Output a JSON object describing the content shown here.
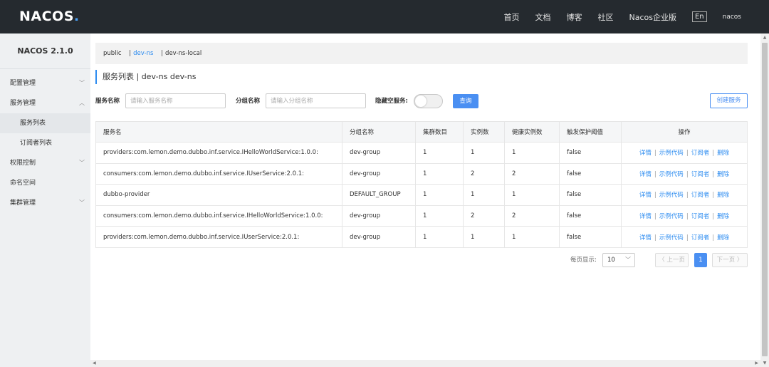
{
  "header": {
    "logo": "NACOS",
    "logo_dot": ".",
    "nav": [
      "首页",
      "文档",
      "博客",
      "社区",
      "Nacos企业版"
    ],
    "lang": "En",
    "user": "nacos"
  },
  "sidebar": {
    "title": "NACOS 2.1.0",
    "items": [
      {
        "label": "配置管理",
        "chevron": "﹀"
      },
      {
        "label": "服务管理",
        "chevron": "︿"
      },
      {
        "label": "服务列表"
      },
      {
        "label": "订阅者列表"
      },
      {
        "label": "权限控制",
        "chevron": "﹀"
      },
      {
        "label": "命名空间"
      },
      {
        "label": "集群管理",
        "chevron": "﹀"
      }
    ]
  },
  "namespaces": {
    "items": [
      "public",
      "dev-ns",
      "dev-ns-local"
    ],
    "separator": "|",
    "active": "dev-ns"
  },
  "page_title": "服务列表 | dev-ns dev-ns",
  "filters": {
    "service_name_label": "服务名称",
    "service_name_placeholder": "请输入服务名称",
    "group_name_label": "分组名称",
    "group_name_placeholder": "请输入分组名称",
    "hide_empty_label": "隐藏空服务:",
    "query_button": "查询",
    "create_button": "创建服务"
  },
  "table": {
    "headers": [
      "服务名",
      "分组名称",
      "集群数目",
      "实例数",
      "健康实例数",
      "触发保护阈值",
      "操作"
    ],
    "ops": [
      "详情",
      "示例代码",
      "订阅者",
      "删除"
    ],
    "ops_sep": "|",
    "rows": [
      [
        "providers:com.lemon.demo.dubbo.inf.service.IHelloWorldService:1.0.0:",
        "dev-group",
        "1",
        "1",
        "1",
        "false"
      ],
      [
        "consumers:com.lemon.demo.dubbo.inf.service.IUserService:2.0.1:",
        "dev-group",
        "1",
        "2",
        "2",
        "false"
      ],
      [
        "dubbo-provider",
        "DEFAULT_GROUP",
        "1",
        "1",
        "1",
        "false"
      ],
      [
        "consumers:com.lemon.demo.dubbo.inf.service.IHelloWorldService:1.0.0:",
        "dev-group",
        "1",
        "2",
        "2",
        "false"
      ],
      [
        "providers:com.lemon.demo.dubbo.inf.service.IUserService:2.0.1:",
        "dev-group",
        "1",
        "1",
        "1",
        "false"
      ]
    ]
  },
  "pagination": {
    "per_page_label": "每页显示:",
    "page_size": "10",
    "prev": "〈 上一页",
    "current": "1",
    "next": "下一页 〉"
  },
  "icons": {
    "chevron_down": "chevron-down-icon",
    "scroll_up": "▲",
    "scroll_down": "▼",
    "scroll_left": "◀",
    "scroll_right": "▶"
  },
  "colors": {
    "header_bg": "#252a2f",
    "accent": "#4a8ff2",
    "link": "#2d8cf0",
    "sidebar_bg": "#eef0f2"
  }
}
